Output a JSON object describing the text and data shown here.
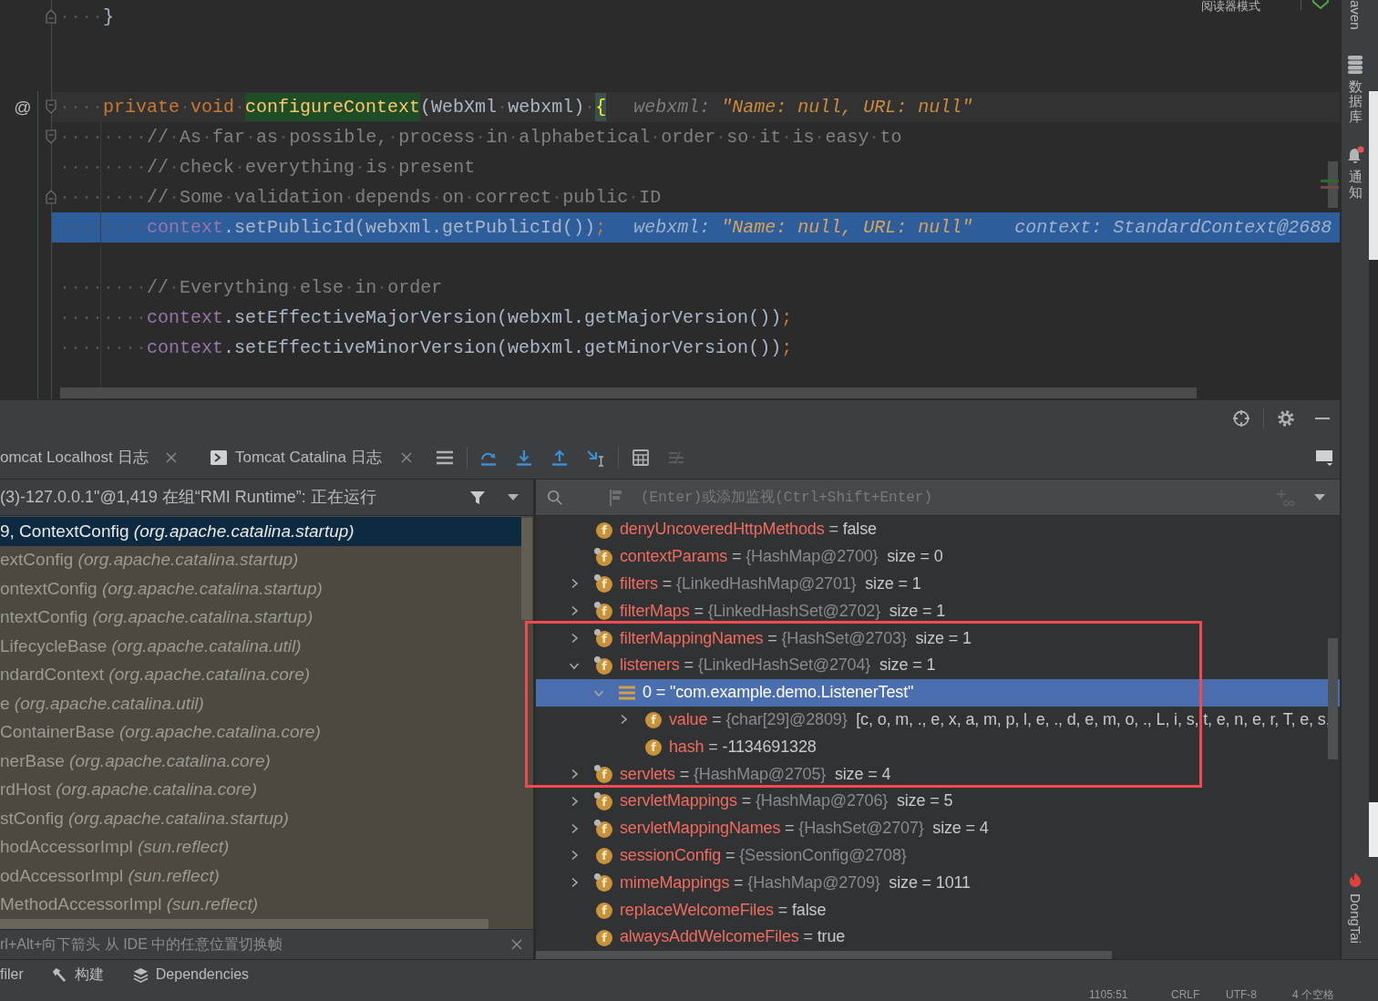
{
  "editor": {
    "reader_mode": "阅读器模式",
    "lines": [
      {
        "kind": "code",
        "caret_line": false,
        "execution_point": false,
        "fold_start": false,
        "fold_end": true,
        "tokens": [
          {
            "kind": "plain",
            "text": "    }"
          }
        ]
      },
      {
        "kind": "blank"
      },
      {
        "kind": "blank"
      },
      {
        "kind": "code",
        "caret_line": true,
        "execution_point": false,
        "fold_start": true,
        "fold_end": false,
        "gutter_mark": "@",
        "tokens": [
          {
            "kind": "keyword",
            "text": "    private void "
          },
          {
            "kind": "method-decl",
            "text": "configureContext"
          },
          {
            "kind": "plain",
            "text": "(WebXml webxml) "
          },
          {
            "kind": "brace-match",
            "text": "{"
          }
        ],
        "hints": [
          {
            "kind": "string",
            "label": "webxml:",
            "value": "\"Name: null, URL: null\""
          }
        ]
      },
      {
        "kind": "code",
        "caret_line": false,
        "execution_point": false,
        "fold_start": true,
        "fold_end": false,
        "tokens": [
          {
            "kind": "comment",
            "text": "        // As far as possible, process in alphabetical order so it is easy to"
          }
        ]
      },
      {
        "kind": "code",
        "caret_line": false,
        "execution_point": false,
        "fold_start": false,
        "fold_end": false,
        "tokens": [
          {
            "kind": "comment",
            "text": "        // check everything is present"
          }
        ]
      },
      {
        "kind": "code",
        "caret_line": false,
        "execution_point": false,
        "fold_start": false,
        "fold_end": true,
        "tokens": [
          {
            "kind": "comment",
            "text": "        // Some validation depends on correct public ID"
          }
        ]
      },
      {
        "kind": "code",
        "caret_line": false,
        "execution_point": true,
        "fold_start": false,
        "fold_end": false,
        "tokens": [
          {
            "kind": "field",
            "text": "        context"
          },
          {
            "kind": "plain",
            "text": ".setPublicId(webxml.getPublicId())"
          },
          {
            "kind": "semicolon",
            "text": ";"
          }
        ],
        "hints": [
          {
            "kind": "string",
            "label": "webxml:",
            "value": "\"Name: null, URL: null\""
          },
          {
            "kind": "object",
            "label": "context:",
            "value": "StandardContext@2688"
          }
        ]
      },
      {
        "kind": "blank"
      },
      {
        "kind": "code",
        "caret_line": false,
        "execution_point": false,
        "fold_start": false,
        "fold_end": false,
        "tokens": [
          {
            "kind": "comment",
            "text": "        // Everything else in order"
          }
        ]
      },
      {
        "kind": "code",
        "caret_line": false,
        "execution_point": false,
        "fold_start": false,
        "fold_end": false,
        "tokens": [
          {
            "kind": "field",
            "text": "        context"
          },
          {
            "kind": "plain",
            "text": ".setEffectiveMajorVersion(webxml.getMajorVersion())"
          },
          {
            "kind": "semicolon",
            "text": ";"
          }
        ]
      },
      {
        "kind": "code",
        "caret_line": false,
        "execution_point": false,
        "fold_start": false,
        "fold_end": false,
        "tokens": [
          {
            "kind": "field",
            "text": "        context"
          },
          {
            "kind": "plain",
            "text": ".setEffectiveMinorVersion(webxml.getMinorVersion())"
          },
          {
            "kind": "semicolon",
            "text": ";"
          }
        ]
      }
    ]
  },
  "debug": {
    "tabs": [
      {
        "kind": "log",
        "label": "omcat Localhost 日志",
        "selected": false
      },
      {
        "kind": "console",
        "label": "Tomcat Catalina 日志",
        "selected": false
      }
    ],
    "toolbar": [
      {
        "disabled": false
      },
      {
        "disabled": false
      },
      {
        "disabled": false
      },
      {
        "disabled": false
      },
      {
        "disabled": false
      },
      {
        "disabled": false
      },
      {
        "disabled": true
      }
    ],
    "frames": {
      "thread": "(3)-127.0.0.1\"@1,419 在组“RMI Runtime”: 正在运行",
      "items": [
        {
          "method": "9, ContextConfig",
          "package": "(org.apache.catalina.startup)",
          "selected": true
        },
        {
          "method": "extConfig",
          "package": "(org.apache.catalina.startup)",
          "selected": false
        },
        {
          "method": "ontextConfig",
          "package": "(org.apache.catalina.startup)",
          "selected": false
        },
        {
          "method": "ntextConfig",
          "package": "(org.apache.catalina.startup)",
          "selected": false
        },
        {
          "method": "LifecycleBase",
          "package": "(org.apache.catalina.util)",
          "selected": false
        },
        {
          "method": "ndardContext",
          "package": "(org.apache.catalina.core)",
          "selected": false
        },
        {
          "method": "e",
          "package": "(org.apache.catalina.util)",
          "selected": false
        },
        {
          "method": "ContainerBase",
          "package": "(org.apache.catalina.core)",
          "selected": false
        },
        {
          "method": "nerBase",
          "package": "(org.apache.catalina.core)",
          "selected": false
        },
        {
          "method": "rdHost",
          "package": "(org.apache.catalina.core)",
          "selected": false
        },
        {
          "method": "stConfig",
          "package": "(org.apache.catalina.startup)",
          "selected": false
        },
        {
          "method": "hodAccessorImpl",
          "package": "(sun.reflect)",
          "selected": false
        },
        {
          "method": "odAccessorImpl",
          "package": "(sun.reflect)",
          "selected": false
        },
        {
          "method": "MethodAccessorImpl",
          "package": "(sun.reflect)",
          "selected": false
        }
      ],
      "hint": "rl+Alt+向下箭头 从 IDE 中的任意位置切换帧"
    },
    "variables": {
      "placeholder": "(Enter)或添加监视(Ctrl+Shift+Enter)",
      "add_watch_disabled": true,
      "items": [
        {
          "kind": "field",
          "icon_letter": "f",
          "final": false,
          "selected": false,
          "expandable": false,
          "name": "denyUncoveredHttpMethods",
          "op": "=",
          "value": "false"
        },
        {
          "kind": "field",
          "icon_letter": "f",
          "final": true,
          "selected": false,
          "expandable": false,
          "name": "contextParams",
          "op": "=",
          "type": "{HashMap@2700}",
          "value": "size = 0"
        },
        {
          "kind": "field",
          "icon_letter": "f",
          "final": true,
          "selected": false,
          "expandable": true,
          "expanded": false,
          "name": "filters",
          "op": "=",
          "type": "{LinkedHashMap@2701}",
          "value": "size = 1"
        },
        {
          "kind": "field",
          "icon_letter": "f",
          "final": true,
          "selected": false,
          "expandable": true,
          "expanded": false,
          "name": "filterMaps",
          "op": "=",
          "type": "{LinkedHashSet@2702}",
          "value": "size = 1"
        },
        {
          "kind": "field",
          "icon_letter": "f",
          "final": true,
          "selected": false,
          "expandable": true,
          "expanded": false,
          "name": "filterMappingNames",
          "op": "=",
          "type": "{HashSet@2703}",
          "value": "size = 1"
        },
        {
          "kind": "field",
          "icon_letter": "f",
          "final": true,
          "selected": false,
          "expandable": true,
          "expanded": true,
          "name": "listeners",
          "op": "=",
          "type": "{LinkedHashSet@2704}",
          "value": "size = 1",
          "children": [
            {
              "kind": "element",
              "selected": true,
              "expandable": true,
              "expanded": true,
              "name": "0",
              "op": "=",
              "value": "\"com.example.demo.ListenerTest\"",
              "children": [
                {
                  "kind": "field",
                  "icon_letter": "f",
                  "final": false,
                  "selected": false,
                  "expandable": true,
                  "expanded": false,
                  "name": "value",
                  "op": "=",
                  "type": "{char[29]@2809}",
                  "value": "[c, o, m, ., e, x, a, m, p, l, e, ., d, e, m, o, ., L, i, s, t, e, n, e, r, T, e, s,"
                },
                {
                  "kind": "field",
                  "icon_letter": "f",
                  "final": false,
                  "selected": false,
                  "expandable": false,
                  "name": "hash",
                  "op": "=",
                  "value": "-1134691328"
                }
              ]
            }
          ]
        },
        {
          "kind": "field",
          "icon_letter": "f",
          "final": true,
          "selected": false,
          "expandable": true,
          "expanded": false,
          "name": "servlets",
          "op": "=",
          "type": "{HashMap@2705}",
          "value": "size = 4"
        },
        {
          "kind": "field",
          "icon_letter": "f",
          "final": true,
          "selected": false,
          "expandable": true,
          "expanded": false,
          "name": "servletMappings",
          "op": "=",
          "type": "{HashMap@2706}",
          "value": "size = 5"
        },
        {
          "kind": "field",
          "icon_letter": "f",
          "final": true,
          "selected": false,
          "expandable": true,
          "expanded": false,
          "name": "servletMappingNames",
          "op": "=",
          "type": "{HashSet@2707}",
          "value": "size = 4"
        },
        {
          "kind": "field",
          "icon_letter": "f",
          "final": false,
          "selected": false,
          "expandable": true,
          "expanded": false,
          "name": "sessionConfig",
          "op": "=",
          "type": "{SessionConfig@2708}"
        },
        {
          "kind": "field",
          "icon_letter": "f",
          "final": true,
          "selected": false,
          "expandable": true,
          "expanded": false,
          "name": "mimeMappings",
          "op": "=",
          "type": "{HashMap@2709}",
          "value": "size = 1011"
        },
        {
          "kind": "field",
          "icon_letter": "f",
          "final": false,
          "selected": false,
          "expandable": false,
          "name": "replaceWelcomeFiles",
          "op": "=",
          "value": "false"
        },
        {
          "kind": "field",
          "icon_letter": "f",
          "final": false,
          "selected": false,
          "expandable": false,
          "name": "alwaysAddWelcomeFiles",
          "op": "=",
          "value": "true"
        }
      ]
    }
  },
  "side_tools": {
    "top": [
      {
        "label": "aven"
      },
      {
        "label": "数据库"
      },
      {
        "label": "通知",
        "unread": true
      }
    ],
    "bottom": [
      {
        "label": "DongTai"
      }
    ]
  },
  "tool_strip": [
    {
      "label": "filer"
    },
    {
      "label": "构建"
    },
    {
      "label": "Dependencies"
    }
  ],
  "status_bar": [
    "1105:51",
    "CRLF",
    "UTF-8",
    "4 个空格"
  ]
}
